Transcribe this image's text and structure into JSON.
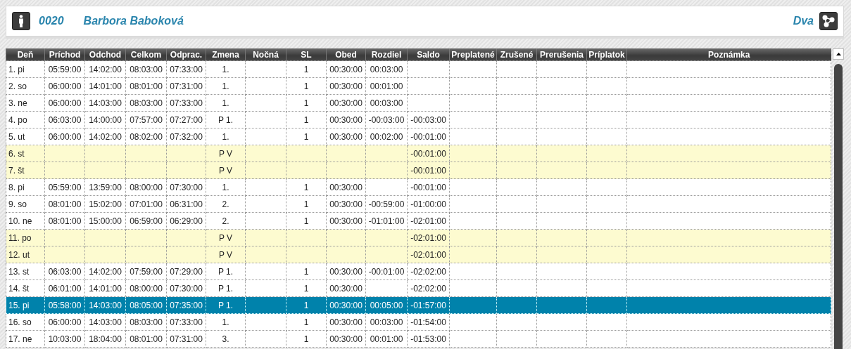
{
  "header": {
    "employee_number": "0020",
    "employee_name": "Barbora Baboková",
    "group": "Dva"
  },
  "table": {
    "columns": [
      "Deň",
      "Príchod",
      "Odchod",
      "Celkom",
      "Odprac.",
      "Zmena",
      "Nočná",
      "SL",
      "Obed",
      "Rozdiel",
      "Saldo",
      "Preplatené",
      "Zrušené",
      "Prerušenia",
      "Príplatok",
      "Poznámka"
    ],
    "rows": [
      {
        "kind": "workday",
        "selected": false,
        "day": "1. pi",
        "arrival": "05:59:00",
        "departure": "14:02:00",
        "total": "08:03:00",
        "worked": "07:33:00",
        "shift": "1.",
        "sl": "1",
        "lunch": "00:30:00",
        "difference": "00:03:00"
      },
      {
        "kind": "workday",
        "selected": false,
        "day": "2. so",
        "arrival": "06:00:00",
        "departure": "14:01:00",
        "total": "08:01:00",
        "worked": "07:31:00",
        "shift": "1.",
        "sl": "1",
        "lunch": "00:30:00",
        "difference": "00:01:00"
      },
      {
        "kind": "workday",
        "selected": false,
        "day": "3. ne",
        "arrival": "06:00:00",
        "departure": "14:03:00",
        "total": "08:03:00",
        "worked": "07:33:00",
        "shift": "1.",
        "sl": "1",
        "lunch": "00:30:00",
        "difference": "00:03:00"
      },
      {
        "kind": "workday",
        "selected": false,
        "day": "4. po",
        "arrival": "06:03:00",
        "departure": "14:00:00",
        "total": "07:57:00",
        "worked": "07:27:00",
        "shift": "P 1.",
        "sl": "1",
        "lunch": "00:30:00",
        "difference": "-00:03:00",
        "balance": "-00:03:00"
      },
      {
        "kind": "workday",
        "selected": false,
        "day": "5. ut",
        "arrival": "06:00:00",
        "departure": "14:02:00",
        "total": "08:02:00",
        "worked": "07:32:00",
        "shift": "1.",
        "sl": "1",
        "lunch": "00:30:00",
        "difference": "00:02:00",
        "balance": "-00:01:00"
      },
      {
        "kind": "free",
        "selected": false,
        "day": "6. st",
        "shift": "P V",
        "balance": "-00:01:00"
      },
      {
        "kind": "free",
        "selected": false,
        "day": "7. št",
        "shift": "P V",
        "balance": "-00:01:00"
      },
      {
        "kind": "workday",
        "selected": false,
        "day": "8. pi",
        "arrival": "05:59:00",
        "departure": "13:59:00",
        "total": "08:00:00",
        "worked": "07:30:00",
        "shift": "1.",
        "sl": "1",
        "lunch": "00:30:00",
        "balance": "-00:01:00"
      },
      {
        "kind": "workday",
        "selected": false,
        "day": "9. so",
        "arrival": "08:01:00",
        "departure": "15:02:00",
        "total": "07:01:00",
        "worked": "06:31:00",
        "shift": "2.",
        "sl": "1",
        "lunch": "00:30:00",
        "difference": "-00:59:00",
        "balance": "-01:00:00"
      },
      {
        "kind": "workday",
        "selected": false,
        "day": "10. ne",
        "arrival": "08:01:00",
        "departure": "15:00:00",
        "total": "06:59:00",
        "worked": "06:29:00",
        "shift": "2.",
        "sl": "1",
        "lunch": "00:30:00",
        "difference": "-01:01:00",
        "balance": "-02:01:00"
      },
      {
        "kind": "free",
        "selected": false,
        "day": "11. po",
        "shift": "P V",
        "balance": "-02:01:00"
      },
      {
        "kind": "free",
        "selected": false,
        "day": "12. ut",
        "shift": "P V",
        "balance": "-02:01:00"
      },
      {
        "kind": "workday",
        "selected": false,
        "day": "13. st",
        "arrival": "06:03:00",
        "departure": "14:02:00",
        "total": "07:59:00",
        "worked": "07:29:00",
        "shift": "P 1.",
        "sl": "1",
        "lunch": "00:30:00",
        "difference": "-00:01:00",
        "balance": "-02:02:00"
      },
      {
        "kind": "workday",
        "selected": false,
        "day": "14. št",
        "arrival": "06:01:00",
        "departure": "14:01:00",
        "total": "08:00:00",
        "worked": "07:30:00",
        "shift": "P 1.",
        "sl": "1",
        "lunch": "00:30:00",
        "balance": "-02:02:00"
      },
      {
        "kind": "workday",
        "selected": true,
        "day": "15. pi",
        "arrival": "05:58:00",
        "departure": "14:03:00",
        "total": "08:05:00",
        "worked": "07:35:00",
        "shift": "P 1.",
        "sl": "1",
        "lunch": "00:30:00",
        "difference": "00:05:00",
        "balance": "-01:57:00"
      },
      {
        "kind": "workday",
        "selected": false,
        "day": "16. so",
        "arrival": "06:00:00",
        "departure": "14:03:00",
        "total": "08:03:00",
        "worked": "07:33:00",
        "shift": "1.",
        "sl": "1",
        "lunch": "00:30:00",
        "difference": "00:03:00",
        "balance": "-01:54:00"
      },
      {
        "kind": "workday",
        "selected": false,
        "day": "17. ne",
        "arrival": "10:03:00",
        "departure": "18:04:00",
        "total": "08:01:00",
        "worked": "07:31:00",
        "shift": "3.",
        "sl": "1",
        "lunch": "00:30:00",
        "difference": "00:01:00",
        "balance": "-01:53:00"
      }
    ]
  }
}
